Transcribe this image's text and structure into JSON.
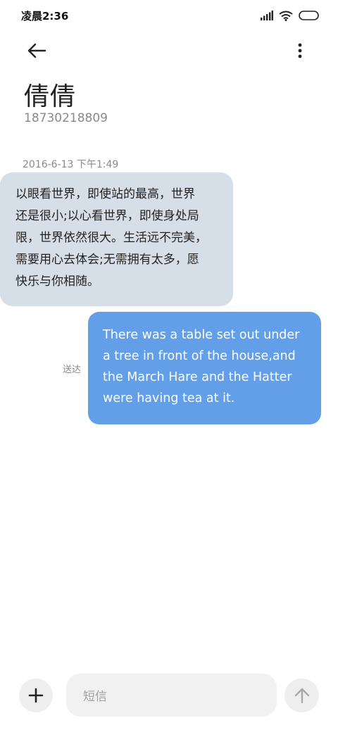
{
  "status_bar": {
    "time": "凌晨2:36",
    "icons": [
      "signal-icon",
      "wifi-icon",
      "battery-icon"
    ]
  },
  "header": {
    "back_icon": "back-arrow-icon",
    "more_icon": "more-vertical-icon"
  },
  "contact": {
    "name": "倩倩",
    "number": "18730218809"
  },
  "conversation": {
    "timestamp": "2016-6-13 下午1:49",
    "incoming": {
      "lines": [
        "以眼看世界，即使站的最高，世界",
        "还是很小;以心看世界，即使身处局",
        "限，世界依然很大。生活远不完美，",
        "需要用心去体会;无需拥有太多，愿",
        "快乐与你相随。"
      ]
    },
    "outgoing": {
      "lines": [
        "There was a table set out under",
        "a tree in front of the house,and",
        "the March Hare and the Hatter",
        "were having tea at it."
      ],
      "status": "送达"
    }
  },
  "composer": {
    "placeholder": "短信",
    "add_icon": "plus-icon",
    "send_icon": "send-arrow-icon"
  },
  "colors": {
    "incoming_bubble": "#d6dee8",
    "outgoing_bubble": "#639fe8",
    "muted_text": "#8a8a8a"
  }
}
